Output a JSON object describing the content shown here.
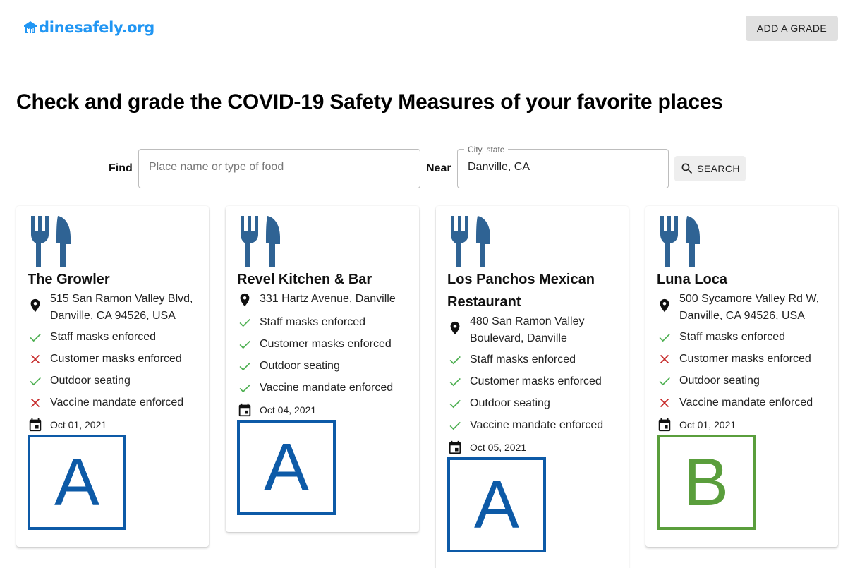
{
  "header": {
    "logo_text": "dinesafely.org",
    "add_grade_label": "ADD A GRADE"
  },
  "headline": "Check and grade the COVID-19 Safety Measures of your favorite places",
  "search": {
    "find_label": "Find",
    "find_placeholder": "Place name or type of food",
    "near_label": "Near",
    "near_legend": "City, state",
    "near_value": "Danville, CA",
    "button_label": "SEARCH"
  },
  "colors": {
    "brand": "#2196f3",
    "icon_blue": "#2f6394",
    "check_green": "#4caf50",
    "cross_red": "#c62828",
    "grade_a": "#0d5aa7",
    "grade_b": "#5a9e3c"
  },
  "restaurants": [
    {
      "name": "The Growler",
      "address_line1": "515 San Ramon Valley Blvd,",
      "address_line2": "Danville, CA 94526, USA",
      "features": [
        {
          "label": "Staff masks enforced",
          "status": "yes"
        },
        {
          "label": "Customer masks enforced",
          "status": "no"
        },
        {
          "label": "Outdoor seating",
          "status": "yes"
        },
        {
          "label": "Vaccine mandate enforced",
          "status": "no"
        }
      ],
      "date": "Oct 01, 2021",
      "grade": "A"
    },
    {
      "name": "Revel Kitchen & Bar",
      "address_line1": "331 Hartz Avenue, Danville",
      "address_line2": "",
      "features": [
        {
          "label": "Staff masks enforced",
          "status": "yes"
        },
        {
          "label": "Customer masks enforced",
          "status": "yes"
        },
        {
          "label": "Outdoor seating",
          "status": "yes"
        },
        {
          "label": "Vaccine mandate enforced",
          "status": "yes"
        }
      ],
      "date": "Oct 04, 2021",
      "grade": "A"
    },
    {
      "name_line1": "Los Panchos Mexican",
      "name_line2": "Restaurant",
      "address_line1": "480 San Ramon Valley",
      "address_line2": "Boulevard, Danville",
      "features": [
        {
          "label": "Staff masks enforced",
          "status": "yes"
        },
        {
          "label": "Customer masks enforced",
          "status": "yes"
        },
        {
          "label": "Outdoor seating",
          "status": "yes"
        },
        {
          "label": "Vaccine mandate enforced",
          "status": "yes"
        }
      ],
      "date": "Oct 05, 2021",
      "grade": "A"
    },
    {
      "name": "Luna Loca",
      "address_line1": "500 Sycamore Valley Rd W,",
      "address_line2": "Danville, CA 94526, USA",
      "features": [
        {
          "label": "Staff masks enforced",
          "status": "yes"
        },
        {
          "label": "Customer masks enforced",
          "status": "no"
        },
        {
          "label": "Outdoor seating",
          "status": "yes"
        },
        {
          "label": "Vaccine mandate enforced",
          "status": "no"
        }
      ],
      "date": "Oct 01, 2021",
      "grade": "B"
    }
  ]
}
